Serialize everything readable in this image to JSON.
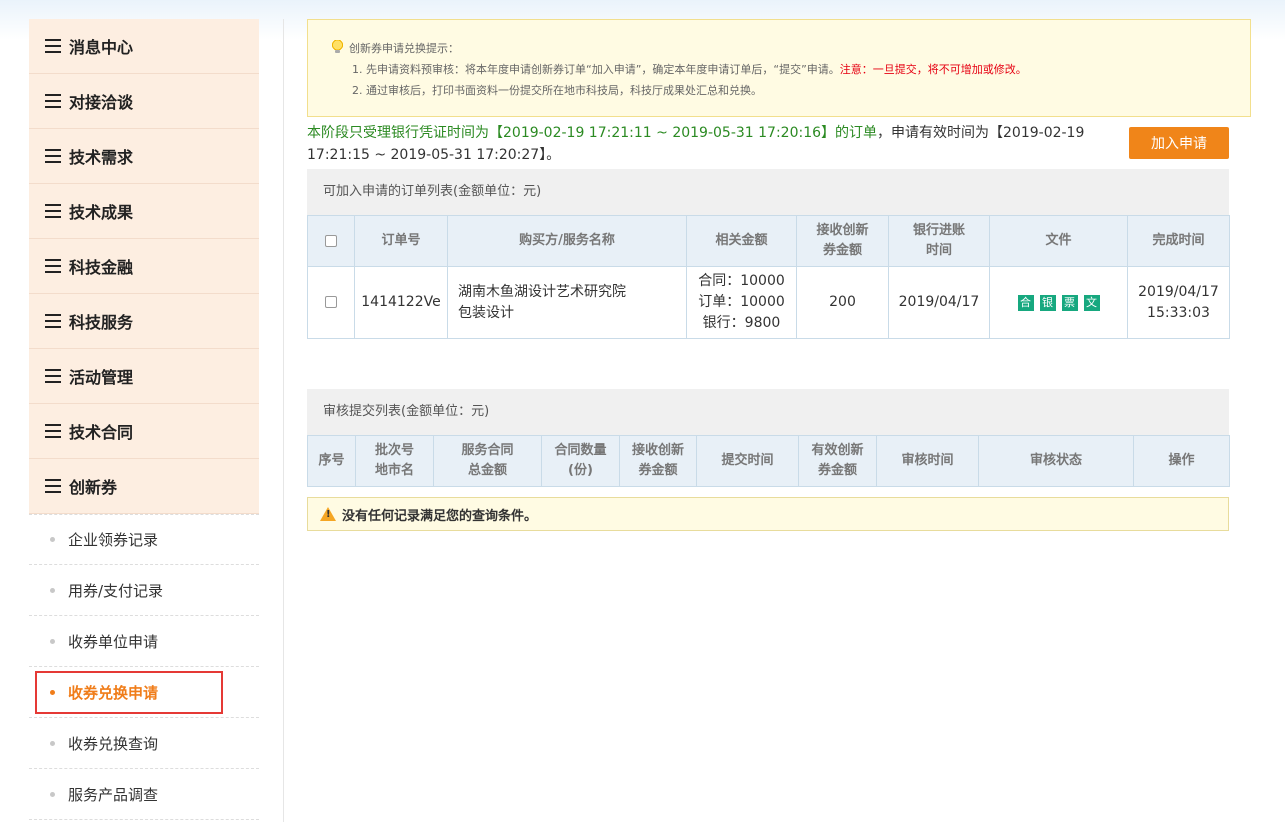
{
  "sidebar": {
    "main_items": [
      {
        "label": "消息中心"
      },
      {
        "label": "对接洽谈"
      },
      {
        "label": "技术需求"
      },
      {
        "label": "技术成果"
      },
      {
        "label": "科技金融"
      },
      {
        "label": "科技服务"
      },
      {
        "label": "活动管理"
      },
      {
        "label": "技术合同"
      },
      {
        "label": "创新券"
      }
    ],
    "sub_items": [
      {
        "label": "企业领券记录"
      },
      {
        "label": "用券/支付记录"
      },
      {
        "label": "收券单位申请"
      },
      {
        "label": "收券兑换申请"
      },
      {
        "label": "收券兑换查询"
      },
      {
        "label": "服务产品调查"
      }
    ],
    "active_sub": "收券兑换申请"
  },
  "notice": {
    "title": "创新券申请兑换提示：",
    "line1": "1. 先申请资料预审核：将本年度申请创新券订单“加入申请”，确定本年度申请订单后，“提交”申请。",
    "line1_warning": "注意：一旦提交，将不可增加或修改。",
    "line2": "2. 通过审核后，打印书面资料一份提交所在地市科技局，科技厅成果处汇总和兑换。"
  },
  "period": {
    "prefix": "本阶段只受理银行凭证时间为【2019-02-19 17:21:11 ~ 2019-05-31 17:20:16】的订单",
    "suffix": "，申请有效时间为【2019-02-19 17:21:15 ~ 2019-05-31 17:20:27】。"
  },
  "add_button": "加入申请",
  "orders": {
    "title": "可加入申请的订单列表(金额单位：元)",
    "headers": [
      "订单号",
      "购买方/服务名称",
      "相关金额",
      "接收创新券金额",
      "银行进账时间",
      "文件",
      "完成时间"
    ],
    "rows": [
      {
        "order_no": "1414122Ve",
        "buyer": "湖南木鱼湖设计艺术研究院",
        "service": "包装设计",
        "amount_contract": "合同：10000",
        "amount_order": "订单：10000",
        "amount_bank": "银行：9800",
        "voucher": "200",
        "bank_date": "2019/04/17",
        "files": [
          "合",
          "银",
          "票",
          "文"
        ],
        "finish_date": "2019/04/17",
        "finish_time": "15:33:03"
      }
    ]
  },
  "review": {
    "title": "审核提交列表(金额单位：元)",
    "headers": [
      "序号",
      "批次号地市名",
      "服务合同总金额",
      "合同数量(份)",
      "接收创新券金额",
      "提交时间",
      "有效创新券金额",
      "审核时间",
      "审核状态",
      "操作"
    ],
    "empty_text": "没有任何记录满足您的查询条件。"
  }
}
